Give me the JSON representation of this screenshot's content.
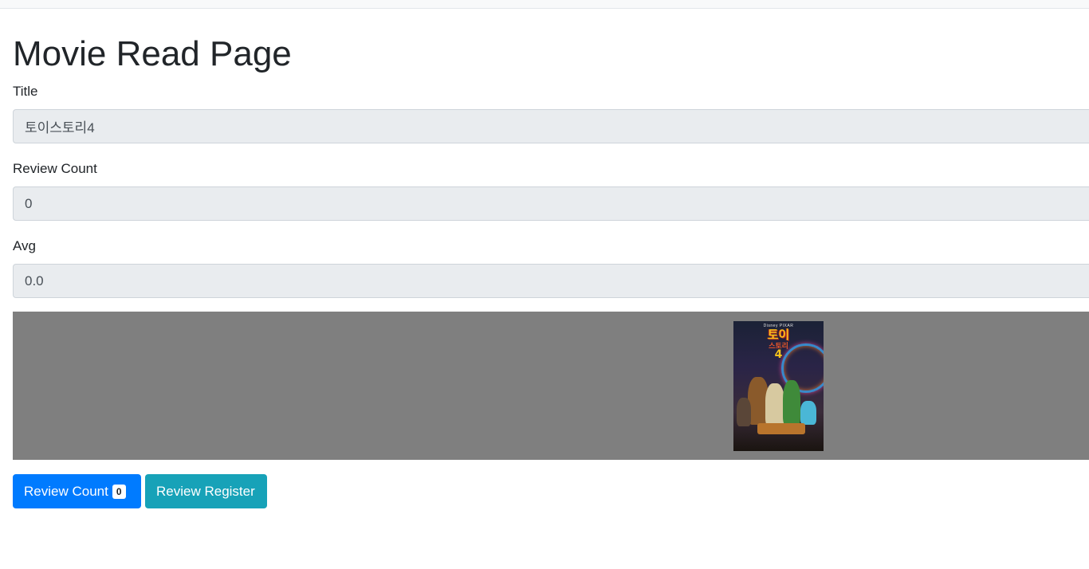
{
  "page": {
    "title": "Movie Read Page"
  },
  "form": {
    "title_label": "Title",
    "title_value": "토이스토리4",
    "review_count_label": "Review Count",
    "review_count_value": "0",
    "avg_label": "Avg",
    "avg_value": "0.0"
  },
  "poster": {
    "icon": "movie-poster-image",
    "brand": "Disney PIXAR",
    "logo_line1": "토이",
    "logo_line2": "스토리",
    "logo_number": "4",
    "strip_color": "#7f7f7f"
  },
  "actions": {
    "review_count_button_label": "Review Count",
    "review_count_badge": "0",
    "review_register_button_label": "Review Register",
    "primary_color": "#007bff",
    "info_color": "#17a2b8"
  }
}
